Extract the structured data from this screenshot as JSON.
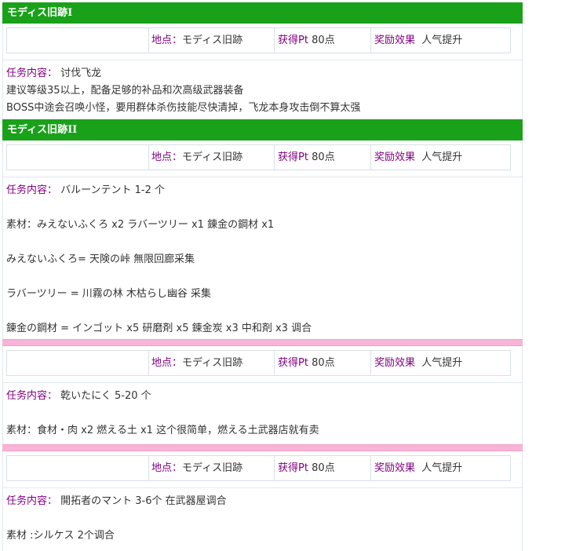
{
  "sections": [
    {
      "title": "モディス旧跡I",
      "info": {
        "place_label": "地点：",
        "place": "モディス旧跡",
        "pt_label": "获得Pt",
        "pt": "80点",
        "reward_label": "奖励效果",
        "reward": "人气提升"
      },
      "task_label": "任务内容：",
      "task": "讨伐飞龙",
      "lines": [
        "建议等级35以上，配备足够的补品和次高级武器装备",
        "BOSS中途会召唤小怪，要用群体杀伤技能尽快清掉，飞龙本身攻击倒不算太强"
      ]
    },
    {
      "title": "モディス旧跡II",
      "info": {
        "place_label": "地点：",
        "place": "モディス旧跡",
        "pt_label": "获得Pt",
        "pt": "80点",
        "reward_label": "奖励效果",
        "reward": "人气提升"
      },
      "task_label": "任务内容：",
      "task": "バルーンテント 1-2 个",
      "lines": [
        "素材：みえないふくろ x2 ラバーツリー x1 錬金の鋼材 x1",
        "みえないふくろ= 天険の峠 無限回廊采集",
        "ラバーツリー = 川霧の林 木枯らし幽谷 采集",
        "錬金の鋼材 = インゴット x5 研磨剤 x5 錬金炭 x3 中和剤 x3 调合"
      ]
    },
    {
      "info": {
        "place_label": "地点：",
        "place": "モディス旧跡",
        "pt_label": "获得Pt",
        "pt": "80点",
        "reward_label": "奖励效果",
        "reward": "人气提升"
      },
      "task_label": "任务内容：",
      "task": "乾いたにく 5-20 个",
      "lines": [
        "素材：食材・肉 x2 燃える土 x1 这个很简单，燃える土武器店就有卖"
      ]
    },
    {
      "info": {
        "place_label": "地点：",
        "place": "モディス旧跡",
        "pt_label": "获得Pt",
        "pt": "80点",
        "reward_label": "奖励效果",
        "reward": "人气提升"
      },
      "task_label": "任务内容：",
      "task": "開拓者のマント 3-6个  在武器屋调合",
      "lines": [
        "素材 :シルケス 2个调合"
      ]
    }
  ]
}
